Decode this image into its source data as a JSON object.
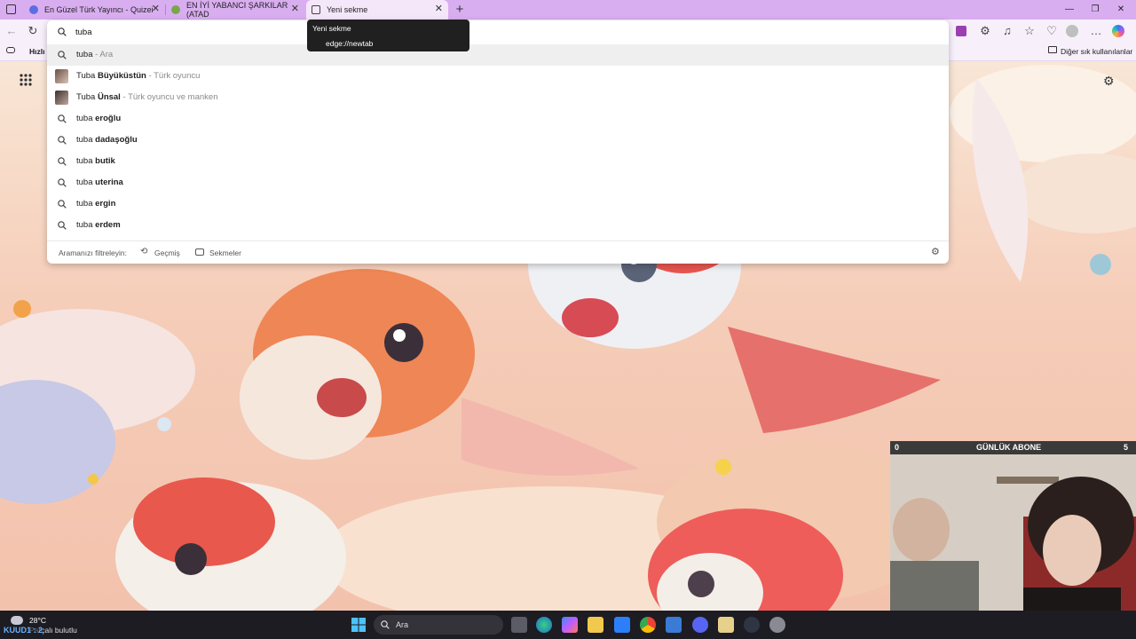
{
  "tabs": [
    {
      "title": "En Güzel Türk Yayıncı - Quizei",
      "favicon_color": "#5b6ee1"
    },
    {
      "title": "EN İYİ YABANCI ŞARKILAR (ATAD",
      "favicon_color": "#7aa64b"
    },
    {
      "title": "Yeni sekme",
      "favicon_color": "#555555",
      "active": true
    }
  ],
  "tooltip": {
    "title": "Yeni sekme",
    "url": "edge://newtab"
  },
  "favorites_bar": {
    "left_label": "Hızlı e",
    "right_label": "Diğer sık kullanılanlar"
  },
  "omnibox": {
    "value": "tuba ",
    "suggestions": [
      {
        "prefix": "tuba",
        "bold": "",
        "sub": " - Ara",
        "kind": "search",
        "highlighted": true
      },
      {
        "prefix": "Tuba ",
        "bold": "Büyüküstün",
        "sub": " - Türk oyuncu",
        "kind": "entity"
      },
      {
        "prefix": "Tuba ",
        "bold": "Ünsal",
        "sub": " - Türk oyuncu ve manken",
        "kind": "entity"
      },
      {
        "prefix": "tuba ",
        "bold": "eroğlu",
        "sub": "",
        "kind": "search"
      },
      {
        "prefix": "tuba ",
        "bold": "dadaşoğlu",
        "sub": "",
        "kind": "search"
      },
      {
        "prefix": "tuba ",
        "bold": "butik",
        "sub": "",
        "kind": "search"
      },
      {
        "prefix": "tuba ",
        "bold": "uterina",
        "sub": "",
        "kind": "search"
      },
      {
        "prefix": "tuba ",
        "bold": "ergin",
        "sub": "",
        "kind": "search"
      },
      {
        "prefix": "tuba ",
        "bold": "erdem",
        "sub": "",
        "kind": "search"
      }
    ],
    "filter_label": "Aramanızı filtreleyin:",
    "filter_history": "Geçmiş",
    "filter_tabs": "Sekmeler"
  },
  "webcam": {
    "title": "GÜNLÜK ABONE",
    "left_count": "0",
    "right_count": "5"
  },
  "taskbar": {
    "weather_temp": "28°C",
    "weather_desc": "Parçalı bulutlu",
    "stream_overlay": "KUUD1 : 2",
    "search_label": "Ara",
    "apps": [
      "start",
      "search",
      "task-view",
      "edge",
      "copilot",
      "file-explorer",
      "store",
      "chrome",
      "game",
      "discord",
      "note",
      "steam",
      "settings"
    ]
  },
  "icons": [
    "tab-actions-icon",
    "back-icon",
    "reload-icon",
    "search-icon",
    "collections-icon",
    "extensions-icon",
    "favorites-icon",
    "profile-icon",
    "copilot-icon",
    "settings-icon",
    "apps-grid-icon"
  ]
}
